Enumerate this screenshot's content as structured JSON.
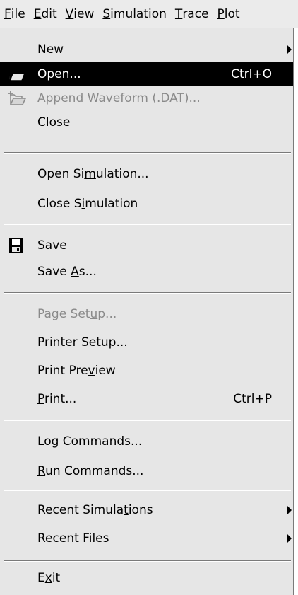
{
  "menubar": {
    "items": [
      {
        "pre": "",
        "key": "F",
        "post": "ile"
      },
      {
        "pre": "",
        "key": "E",
        "post": "dit"
      },
      {
        "pre": "",
        "key": "V",
        "post": "iew"
      },
      {
        "pre": "",
        "key": "S",
        "post": "imulation"
      },
      {
        "pre": "",
        "key": "T",
        "post": "race"
      },
      {
        "pre": "",
        "key": "P",
        "post": "lot"
      }
    ]
  },
  "menu": {
    "new": {
      "pre": "",
      "key": "N",
      "post": "ew"
    },
    "open": {
      "pre": "",
      "key": "O",
      "post": "pen...",
      "shortcut": "Ctrl+O"
    },
    "append": {
      "pre": "Append ",
      "key": "W",
      "post": "aveform (.DAT)..."
    },
    "close": {
      "pre": "",
      "key": "C",
      "post": "lose"
    },
    "open_sim": {
      "pre": "Open Si",
      "key": "m",
      "post": "ulation..."
    },
    "close_sim": {
      "pre": "Close S",
      "key": "i",
      "post": "mulation"
    },
    "save": {
      "pre": "",
      "key": "S",
      "post": "ave"
    },
    "save_as": {
      "pre": "Save ",
      "key": "A",
      "post": "s..."
    },
    "page_setup": {
      "pre": "Page Set",
      "key": "u",
      "post": "p..."
    },
    "printer_setup": {
      "pre": "Printer S",
      "key": "e",
      "post": "tup..."
    },
    "print_preview": {
      "pre": "Print Pre",
      "key": "v",
      "post": "iew"
    },
    "print": {
      "pre": "",
      "key": "P",
      "post": "rint...",
      "shortcut": "Ctrl+P"
    },
    "log_cmds": {
      "pre": "",
      "key": "L",
      "post": "og Commands..."
    },
    "run_cmds": {
      "pre": "",
      "key": "R",
      "post": "un Commands..."
    },
    "recent_sims": {
      "pre": "Recent Simula",
      "key": "t",
      "post": "ions"
    },
    "recent_files": {
      "pre": "Recent ",
      "key": "F",
      "post": "iles"
    },
    "exit": {
      "pre": "E",
      "key": "x",
      "post": "it"
    }
  }
}
